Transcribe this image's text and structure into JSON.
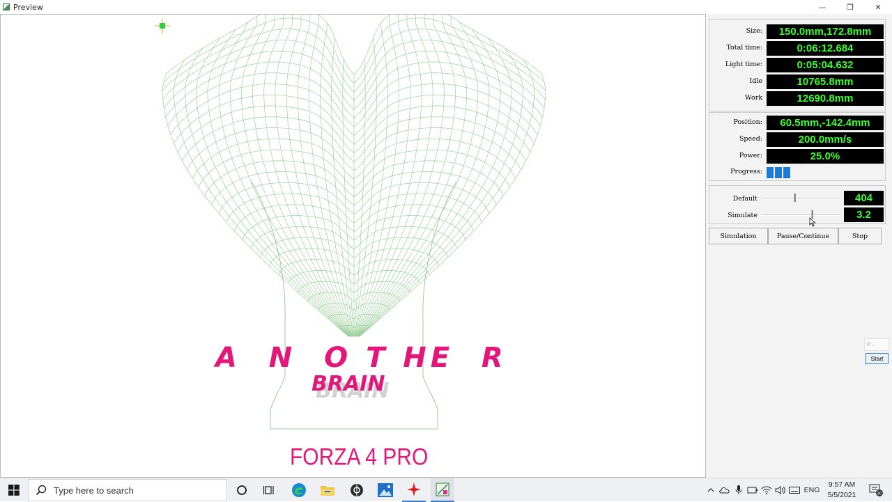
{
  "window": {
    "title": "Preview",
    "controls": {
      "minimize": "—",
      "restore": "❐",
      "close": "✕"
    }
  },
  "stats": {
    "size_label": "Size:",
    "size_value": "150.0mm,172.8mm",
    "total_time_label": "Total time:",
    "total_time_value": "0:06:12.684",
    "light_time_label": "Light time:",
    "light_time_value": "0:05:04.632",
    "idle_label": "Idle",
    "idle_value": "10765.8mm",
    "work_label": "Work",
    "work_value": "12690.8mm"
  },
  "status": {
    "position_label": "Position:",
    "position_value": "60.5mm,-142.4mm",
    "speed_label": "Speed:",
    "speed_value": "200.0mm/s",
    "power_label": "Power:",
    "power_value": "25.0%",
    "progress_label": "Progress:",
    "progress_blocks": 3
  },
  "sliders": {
    "default_label": "Default",
    "default_value": "404",
    "default_level": 0.42,
    "simulate_label": "Simulate",
    "simulate_value": "3.2",
    "simulate_level": 0.64
  },
  "buttons": {
    "simulation": "Simulation",
    "pause_continue": "Pause/Continue",
    "stop": "Stop"
  },
  "mini_widget": {
    "top": "P...",
    "start": "Start"
  },
  "design": {
    "text_another": "A  N  O T HE  R",
    "text_brain": "BRAIN",
    "text_brand": "FORZA 4 PRO",
    "colors": {
      "pink": "#e3177a",
      "mesh": "#9ccf9c",
      "outline": "#9fc99f",
      "cursor_green": "#27d23a",
      "cursor_orange": "#f0a020"
    }
  },
  "taskbar": {
    "search_placeholder": "Type here to search",
    "tray_language": "ENG",
    "clock_time": "9:57 AM",
    "clock_date": "5/5/2021",
    "notification_count": "30",
    "icons": [
      "windows-start-icon",
      "search-icon",
      "cortana-icon",
      "task-view-icon",
      "edge-icon",
      "file-explorer-icon",
      "app-dark-icon",
      "photos-icon",
      "laser-app-icon",
      "preview-app-icon"
    ]
  }
}
